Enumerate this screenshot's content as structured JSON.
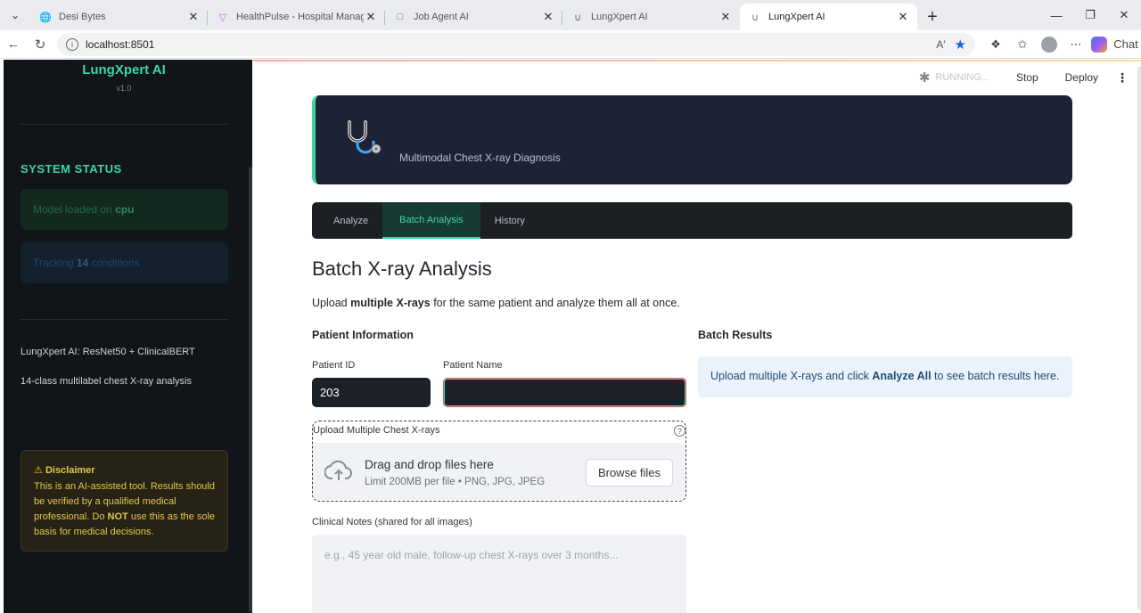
{
  "browser": {
    "tabs": [
      {
        "title": "Desi Bytes",
        "icon": "globe-icon",
        "active": false
      },
      {
        "title": "HealthPulse - Hospital Managemen",
        "icon": "healthpulse-icon",
        "active": false
      },
      {
        "title": "Job Agent AI",
        "icon": "jobagent-icon",
        "active": false
      },
      {
        "title": "LungXpert AI",
        "icon": "stethoscope-icon",
        "active": false
      },
      {
        "title": "LungXpert AI",
        "icon": "stethoscope-icon",
        "active": true
      }
    ],
    "url": "localhost:8501",
    "chat_label": "Chat"
  },
  "sidebar": {
    "title": "LungXpert AI",
    "version": "v1.0",
    "status_heading": "SYSTEM STATUS",
    "model_prefix": "Model loaded on ",
    "model_device": "cpu",
    "tracking_prefix": "Tracking ",
    "tracking_count": "14",
    "tracking_suffix": " conditions",
    "about_line1": "LungXpert AI: ResNet50 + ClinicalBERT",
    "about_line2": "14-class multilabel chest X-ray analysis",
    "disclaimer": {
      "heading": "Disclaimer",
      "text_a": "This is an AI-assisted tool. Results should be verified by a qualified medical professional. Do ",
      "text_not": "NOT",
      "text_b": " use this as the sole basis for medical decisions."
    }
  },
  "toolbar": {
    "running": "RUNNING...",
    "stop": "Stop",
    "deploy": "Deploy"
  },
  "banner": {
    "subtitle": "Multimodal Chest X-ray Diagnosis"
  },
  "tabs": [
    {
      "label": "Analyze",
      "active": false
    },
    {
      "label": "Batch Analysis",
      "active": true
    },
    {
      "label": "History",
      "active": false
    }
  ],
  "page": {
    "heading": "Batch X-ray Analysis",
    "desc_a": "Upload ",
    "desc_b": "multiple X-rays",
    "desc_c": " for the same patient and analyze them all at once."
  },
  "patient": {
    "section": "Patient Information",
    "id_label": "Patient ID",
    "id_value": "203",
    "name_label": "Patient Name",
    "name_value": ""
  },
  "upload": {
    "label": "Upload Multiple Chest X-rays",
    "drag_text": "Drag and drop files here",
    "limit_text": "Limit 200MB per file • PNG, JPG, JPEG",
    "browse": "Browse files"
  },
  "notes": {
    "label": "Clinical Notes (shared for all images)",
    "placeholder": "e.g., 45 year old male, follow-up chest X-rays over 3 months..."
  },
  "results": {
    "section": "Batch Results",
    "text_a": "Upload multiple X-rays and click ",
    "text_b": "Analyze All",
    "text_c": " to see batch results here."
  },
  "colors": {
    "accent": "#3dd6a0",
    "banner_bg": "#1c2336",
    "sidebar_bg": "#111418"
  }
}
